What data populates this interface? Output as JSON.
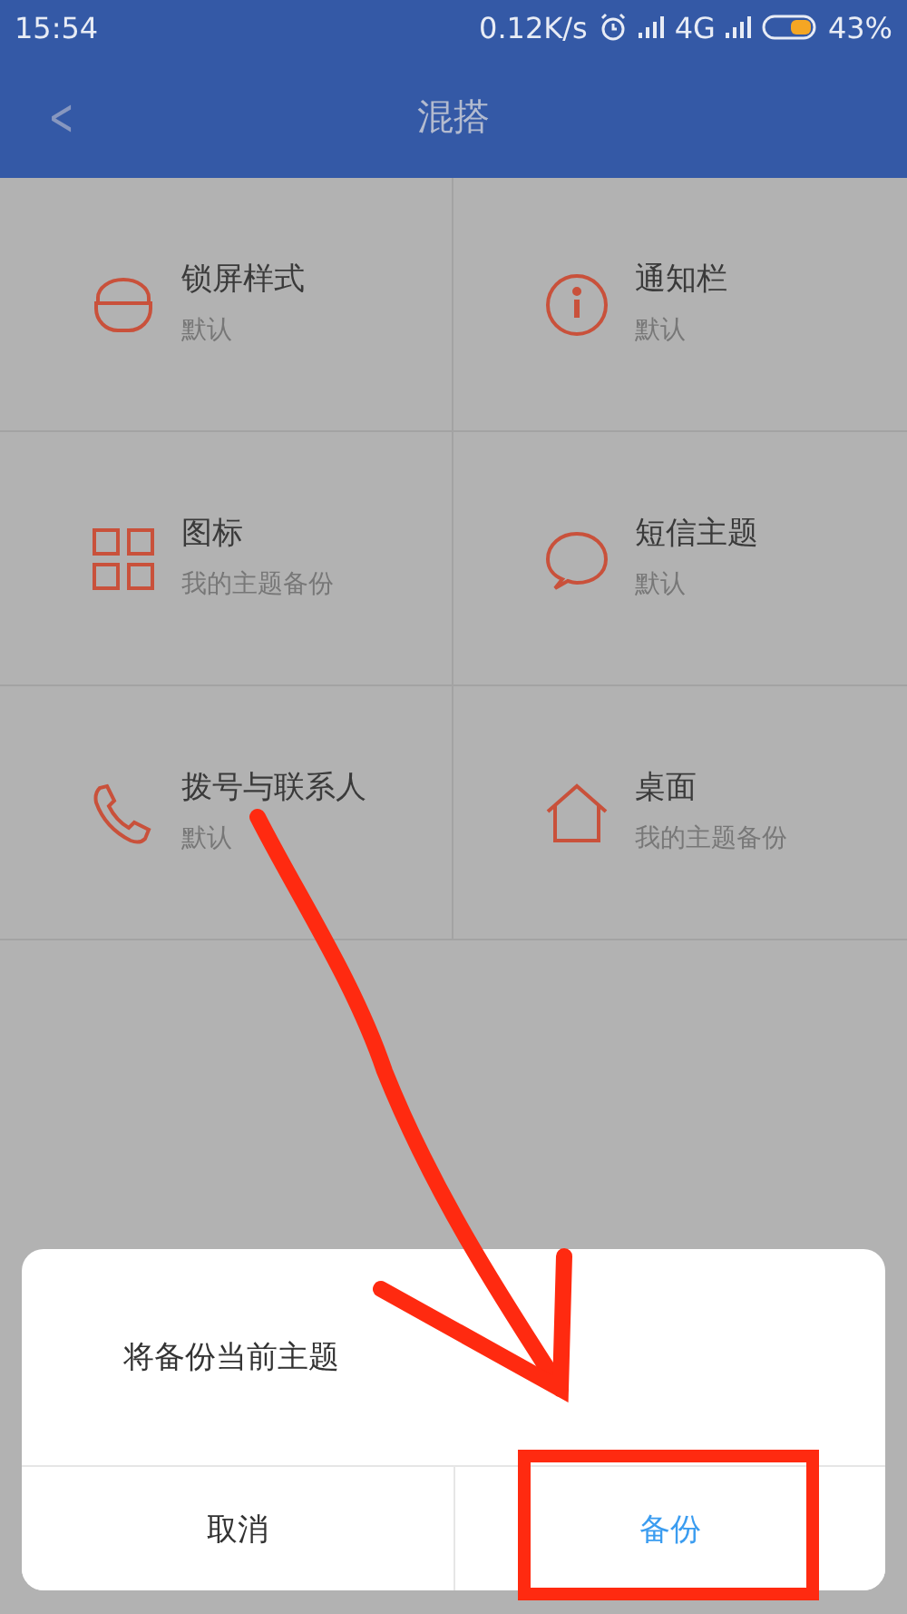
{
  "status_bar": {
    "time": "15:54",
    "speed": "0.12K/s",
    "network": "4G",
    "battery": "43%"
  },
  "header": {
    "back": "<",
    "title": "混搭"
  },
  "items": [
    {
      "title": "锁屏样式",
      "value": "默认"
    },
    {
      "title": "通知栏",
      "value": "默认"
    },
    {
      "title": "图标",
      "value": "我的主题备份"
    },
    {
      "title": "短信主题",
      "value": "默认"
    },
    {
      "title": "拨号与联系人",
      "value": "默认"
    },
    {
      "title": "桌面",
      "value": "我的主题备份"
    }
  ],
  "dialog": {
    "message": "将备份当前主题",
    "buttons": [
      {
        "label": "取消",
        "kind": "cancel"
      },
      {
        "label": "备份",
        "kind": "confirm"
      }
    ]
  }
}
